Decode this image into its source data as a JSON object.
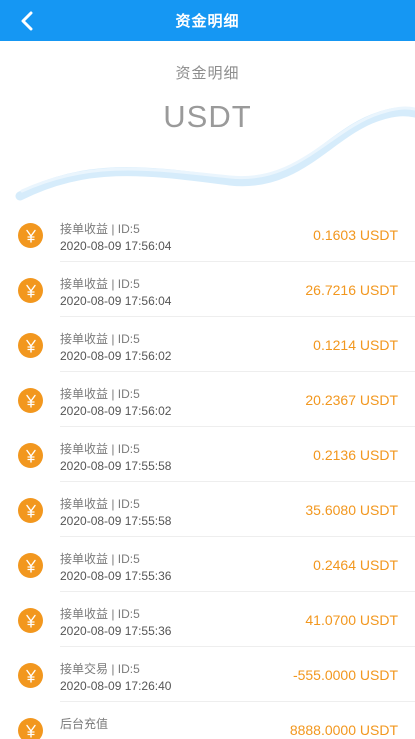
{
  "header": {
    "title": "资金明细",
    "back_icon": "chevron-left-icon"
  },
  "hero": {
    "subtitle": "资金明细",
    "currency": "USDT",
    "wave_color": "#d6ecfb"
  },
  "colors": {
    "primary": "#1597f3",
    "accent": "#f2971e"
  },
  "coin_icon": "yuan-coin-icon",
  "transactions": [
    {
      "name": "接单收益 | ID:5",
      "date": "2020-08-09 17:56:04",
      "amount": "0.1603 USDT"
    },
    {
      "name": "接单收益 | ID:5",
      "date": "2020-08-09 17:56:04",
      "amount": "26.7216 USDT"
    },
    {
      "name": "接单收益 | ID:5",
      "date": "2020-08-09 17:56:02",
      "amount": "0.1214 USDT"
    },
    {
      "name": "接单收益 | ID:5",
      "date": "2020-08-09 17:56:02",
      "amount": "20.2367 USDT"
    },
    {
      "name": "接单收益 | ID:5",
      "date": "2020-08-09 17:55:58",
      "amount": "0.2136 USDT"
    },
    {
      "name": "接单收益 | ID:5",
      "date": "2020-08-09 17:55:58",
      "amount": "35.6080 USDT"
    },
    {
      "name": "接单收益 | ID:5",
      "date": "2020-08-09 17:55:36",
      "amount": "0.2464 USDT"
    },
    {
      "name": "接单收益 | ID:5",
      "date": "2020-08-09 17:55:36",
      "amount": "41.0700 USDT"
    },
    {
      "name": "接单交易 | ID:5",
      "date": "2020-08-09 17:26:40",
      "amount": "-555.0000 USDT"
    },
    {
      "name": "后台充值",
      "date": "",
      "amount": "8888.0000 USDT"
    }
  ]
}
